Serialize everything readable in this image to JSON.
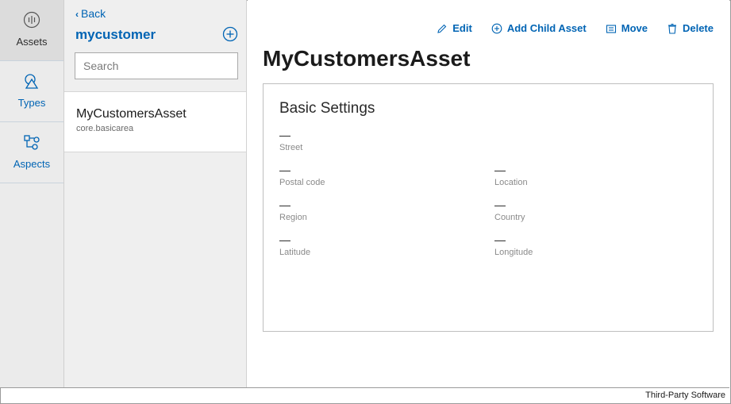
{
  "nav": {
    "items": [
      {
        "label": "Assets",
        "icon": "assets-icon"
      },
      {
        "label": "Types",
        "icon": "types-icon"
      },
      {
        "label": "Aspects",
        "icon": "aspects-icon"
      }
    ]
  },
  "panel": {
    "back_label": "Back",
    "title": "mycustomer",
    "search_placeholder": "Search",
    "assets": [
      {
        "name": "MyCustomersAsset",
        "type": "core.basicarea"
      }
    ]
  },
  "toolbar": {
    "edit": "Edit",
    "add_child": "Add Child Asset",
    "move": "Move",
    "delete": "Delete"
  },
  "asset": {
    "title": "MyCustomersAsset",
    "section_title": "Basic Settings",
    "fields": {
      "street": {
        "value": "—",
        "label": "Street"
      },
      "postal_code": {
        "value": "—",
        "label": "Postal code"
      },
      "location": {
        "value": "—",
        "label": "Location"
      },
      "region": {
        "value": "—",
        "label": "Region"
      },
      "country": {
        "value": "—",
        "label": "Country"
      },
      "latitude": {
        "value": "—",
        "label": "Latitude"
      },
      "longitude": {
        "value": "—",
        "label": "Longitude"
      }
    }
  },
  "footer": {
    "text": "Third-Party Software"
  },
  "colors": {
    "accent": "#0064b4",
    "rail_bg": "#ebebeb",
    "panel_bg": "#efefef"
  }
}
